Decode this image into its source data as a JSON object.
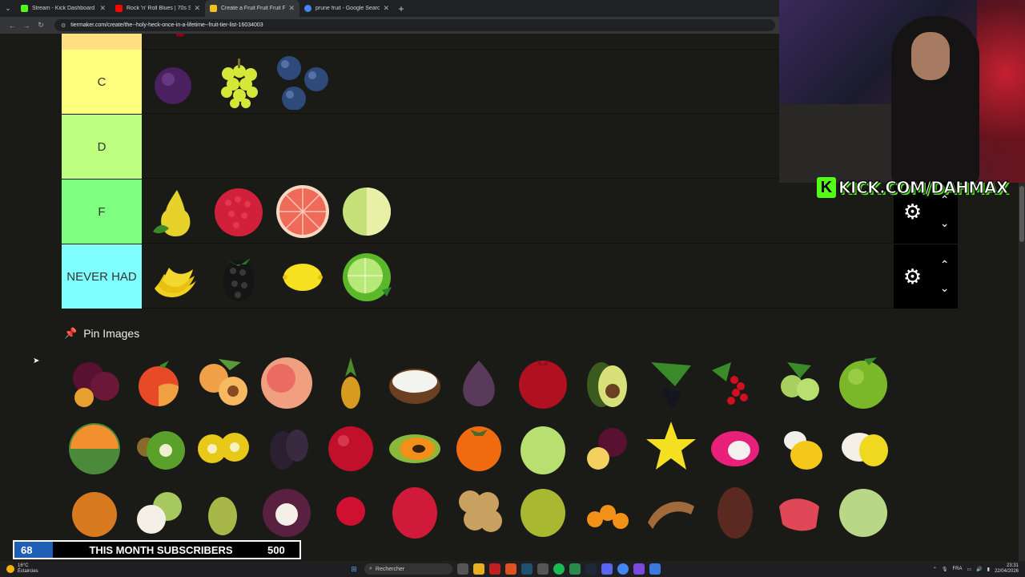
{
  "browser": {
    "tabs": [
      {
        "label": "Stream - Kick Dashboard",
        "favicon_color": "#53fc18"
      },
      {
        "label": "Rock 'n' Roll Blues | 70s Sum",
        "favicon_color": "#ff0000"
      },
      {
        "label": "Create a Fruit Fruit Fruit F",
        "favicon_color": "#f0c020",
        "active": true
      },
      {
        "label": "prune fruit - Google Search",
        "favicon_color": "#4285f4"
      }
    ],
    "url": "tiermaker.com/create/the--holy-heck-once-in-a-lifetime--fruit-tier-list-16034003"
  },
  "tiers": [
    {
      "label": "",
      "color": "#ffdf7f",
      "items": [
        "cherry"
      ]
    },
    {
      "label": "C",
      "color": "#ffff7f",
      "items": [
        "plum",
        "green-grapes",
        "blueberries"
      ]
    },
    {
      "label": "D",
      "color": "#bfff7f",
      "items": []
    },
    {
      "label": "F",
      "color": "#7fff7f",
      "items": [
        "pear",
        "raspberry",
        "grapefruit",
        "honeydew"
      ]
    },
    {
      "label": "NEVER HAD",
      "color": "#7fffff",
      "items": [
        "banana",
        "blackberry",
        "lemon",
        "lime"
      ]
    }
  ],
  "pin_images": {
    "title": "Pin Images",
    "rows": [
      [
        "plums",
        "nectarine",
        "apricots",
        "peach",
        "pineapple",
        "coconut",
        "fig",
        "pomegranate",
        "avocado",
        "blackcurrant",
        "redcurrant",
        "gooseberry",
        "green-apple"
      ],
      [
        "cantaloupe",
        "kiwi",
        "golden-kiwi",
        "mulberry",
        "cranberry",
        "papaya",
        "persimmon",
        "guava",
        "passion-fruit",
        "starfruit",
        "dragon-fruit",
        "yellow-dragon-fruit",
        "white-dragon-fruit"
      ],
      [
        "quince",
        "longan",
        "feijoa",
        "mangosteen",
        "rambutan",
        "lychee",
        "lanzones",
        "durian",
        "physalis",
        "tamarind",
        "salak",
        "rose-apple",
        "custard-apple"
      ]
    ]
  },
  "overlay": {
    "kick_url": "KICK.COM/DAHMAX",
    "subs_current": "68",
    "subs_label": "THIS MONTH SUBSCRIBERS",
    "subs_goal": "500",
    "subs_progress": 0.136
  },
  "taskbar": {
    "weather_temp": "16°C",
    "weather_desc": "Éclaircies",
    "search_placeholder": "Rechercher",
    "lang": "FRA",
    "time": "23:31",
    "date": "22/04/2026"
  }
}
